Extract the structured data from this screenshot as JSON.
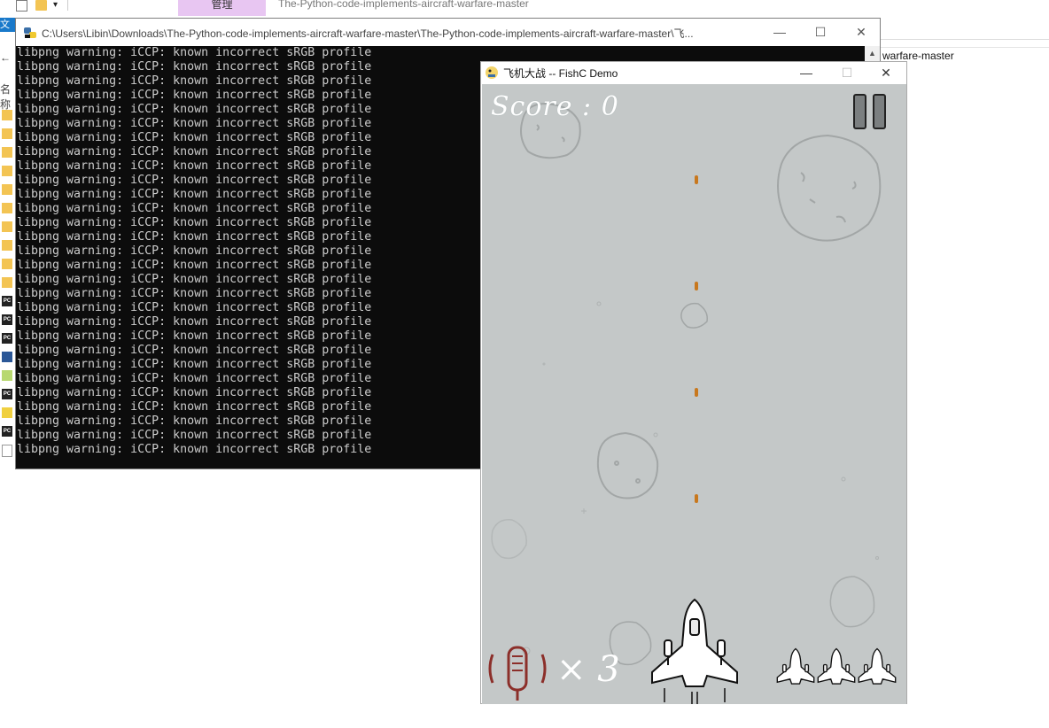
{
  "explorer": {
    "ribbon_tab": "管理",
    "title": "The-Python-code-implements-aircraft-warfare-master",
    "file_tab": "文件",
    "address_tail": "warfare-master",
    "column_name": "名称",
    "qa_dropdown": "▾",
    "back_arrow": "←",
    "sidebar_icons": [
      "folder-icon",
      "folder-icon",
      "folder-icon",
      "folder-icon",
      "folder-icon",
      "folder-icon",
      "folder-icon",
      "folder-icon",
      "folder-icon",
      "folder-icon",
      "pycharm-icon",
      "pycharm-icon",
      "pycharm-icon",
      "word-icon",
      "notepad-icon",
      "pycharm-icon",
      "python-icon",
      "pycharm-icon",
      "document-icon"
    ]
  },
  "console": {
    "title": "C:\\Users\\Libin\\Downloads\\The-Python-code-implements-aircraft-warfare-master\\The-Python-code-implements-aircraft-warfare-master\\飞...",
    "line": "libpng warning: iCCP: known incorrect sRGB profile",
    "line_count": 29,
    "minimize": "—",
    "maximize": "☐",
    "close": "✕",
    "scroll_up": "▲"
  },
  "game": {
    "title": "飞机大战 -- FishC Demo",
    "minimize": "—",
    "maximize": "☐",
    "close": "✕",
    "score_text": "Score : 0",
    "bomb_count_text": "× 3",
    "lives": 3,
    "colors": {
      "background": "#c4c8c8",
      "bullet": "#c8781e",
      "bomb": "#8c2f2a",
      "score": "#ffffff"
    }
  }
}
